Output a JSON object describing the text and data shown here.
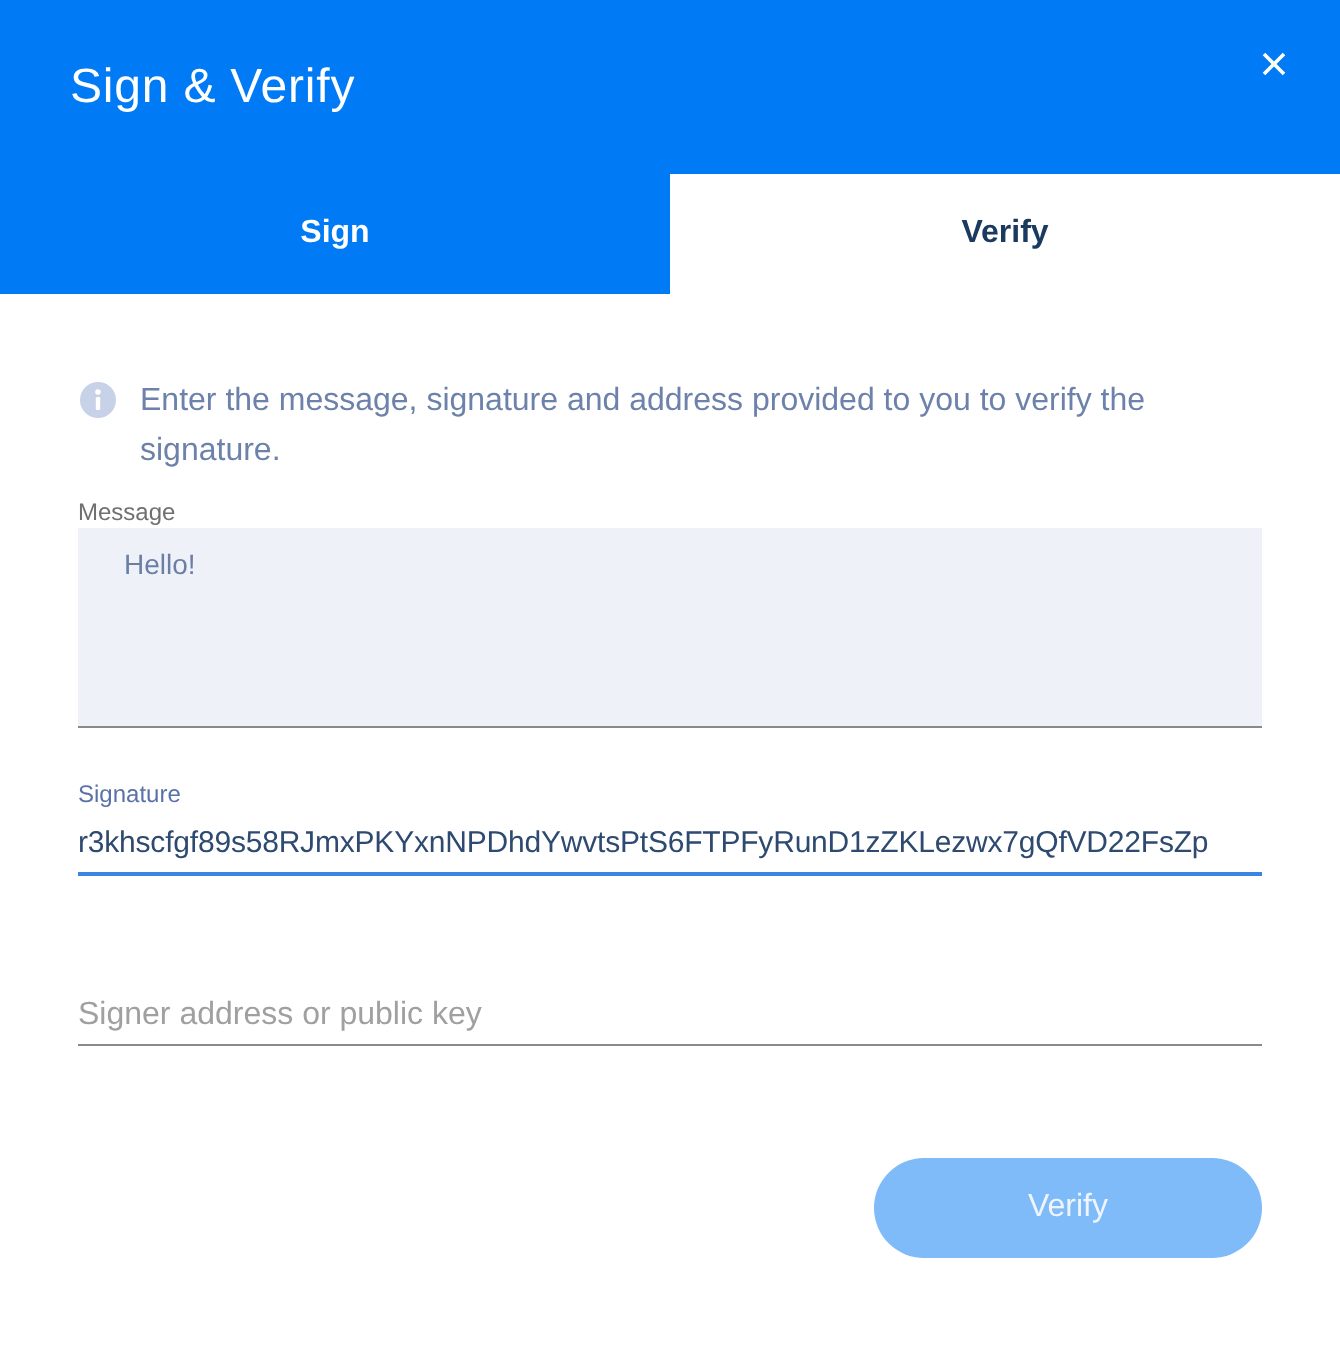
{
  "window": {
    "title": "Sign & Verify"
  },
  "tabs": [
    {
      "label": "Sign",
      "selected": false
    },
    {
      "label": "Verify",
      "selected": true
    }
  ],
  "info": {
    "text": "Enter the message, signature and address provided to you to verify the signature."
  },
  "fields": [
    {
      "kind": "textarea",
      "label": "Message",
      "value": "Hello!",
      "focused": false
    },
    {
      "kind": "input",
      "label": "Signature",
      "value": "r3khscfgf89s58RJmxPKYxnNPDhdYwvtsPtS6FTPFyRunD1zZKLezwx7gQfVD22FsZp",
      "focused": true
    },
    {
      "kind": "input",
      "placeholder": "Signer address or public key",
      "focused": false
    }
  ],
  "buttons": [
    {
      "label": "Verify",
      "disabled": true
    }
  ]
}
